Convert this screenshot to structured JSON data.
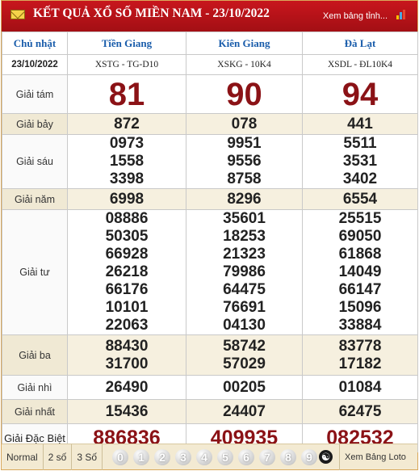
{
  "header": {
    "title": "KẾT QUẢ XỔ SỐ MIỀN NAM - 23/10/2022",
    "link": "Xem bảng tỉnh...",
    "mail_icon": "mail-icon",
    "chart_icon": "bar-chart-icon"
  },
  "table": {
    "day": "Chủ nhật",
    "date": "23/10/2022",
    "provinces": [
      {
        "name": "Tiền Giang",
        "code": "XSTG - TG-D10"
      },
      {
        "name": "Kiên Giang",
        "code": "XSKG - 10K4"
      },
      {
        "name": "Đà Lạt",
        "code": "XSDL - ĐL10K4"
      }
    ],
    "prizes": [
      {
        "label": "Giải tám",
        "values": [
          [
            "81"
          ],
          [
            "90"
          ],
          [
            "94"
          ]
        ]
      },
      {
        "label": "Giải bảy",
        "values": [
          [
            "872"
          ],
          [
            "078"
          ],
          [
            "441"
          ]
        ]
      },
      {
        "label": "Giải sáu",
        "values": [
          [
            "0973",
            "1558",
            "3398"
          ],
          [
            "9951",
            "9556",
            "8758"
          ],
          [
            "5511",
            "3531",
            "3402"
          ]
        ]
      },
      {
        "label": "Giải năm",
        "values": [
          [
            "6998"
          ],
          [
            "8296"
          ],
          [
            "6554"
          ]
        ]
      },
      {
        "label": "Giải tư",
        "values": [
          [
            "08886",
            "50305",
            "66928",
            "26218",
            "66176",
            "10101",
            "22063"
          ],
          [
            "35601",
            "18253",
            "21323",
            "79986",
            "64475",
            "76691",
            "04130"
          ],
          [
            "25515",
            "69050",
            "61868",
            "14049",
            "66147",
            "15096",
            "33884"
          ]
        ]
      },
      {
        "label": "Giải ba",
        "values": [
          [
            "88430",
            "31700"
          ],
          [
            "58742",
            "57029"
          ],
          [
            "83778",
            "17182"
          ]
        ]
      },
      {
        "label": "Giải nhì",
        "values": [
          [
            "26490"
          ],
          [
            "00205"
          ],
          [
            "01084"
          ]
        ]
      },
      {
        "label": "Giải nhất",
        "values": [
          [
            "15436"
          ],
          [
            "24407"
          ],
          [
            "62475"
          ]
        ]
      },
      {
        "label": "Giải Đặc Biệt",
        "values": [
          [
            "886836"
          ],
          [
            "409935"
          ],
          [
            "082532"
          ]
        ]
      }
    ]
  },
  "footer": {
    "options": [
      "Normal",
      "2 số",
      "3 Số"
    ],
    "digits": [
      "0",
      "1",
      "2",
      "3",
      "4",
      "5",
      "6",
      "7",
      "8",
      "9"
    ],
    "yin_yang_icon": "yin-yang-icon",
    "loto_link": "Xem Bảng Loto"
  },
  "colors": {
    "header_bg": "#b5121b",
    "province_text": "#1a5dab",
    "highlight_number": "#8b1216",
    "shade_row": "#f6f0df"
  }
}
